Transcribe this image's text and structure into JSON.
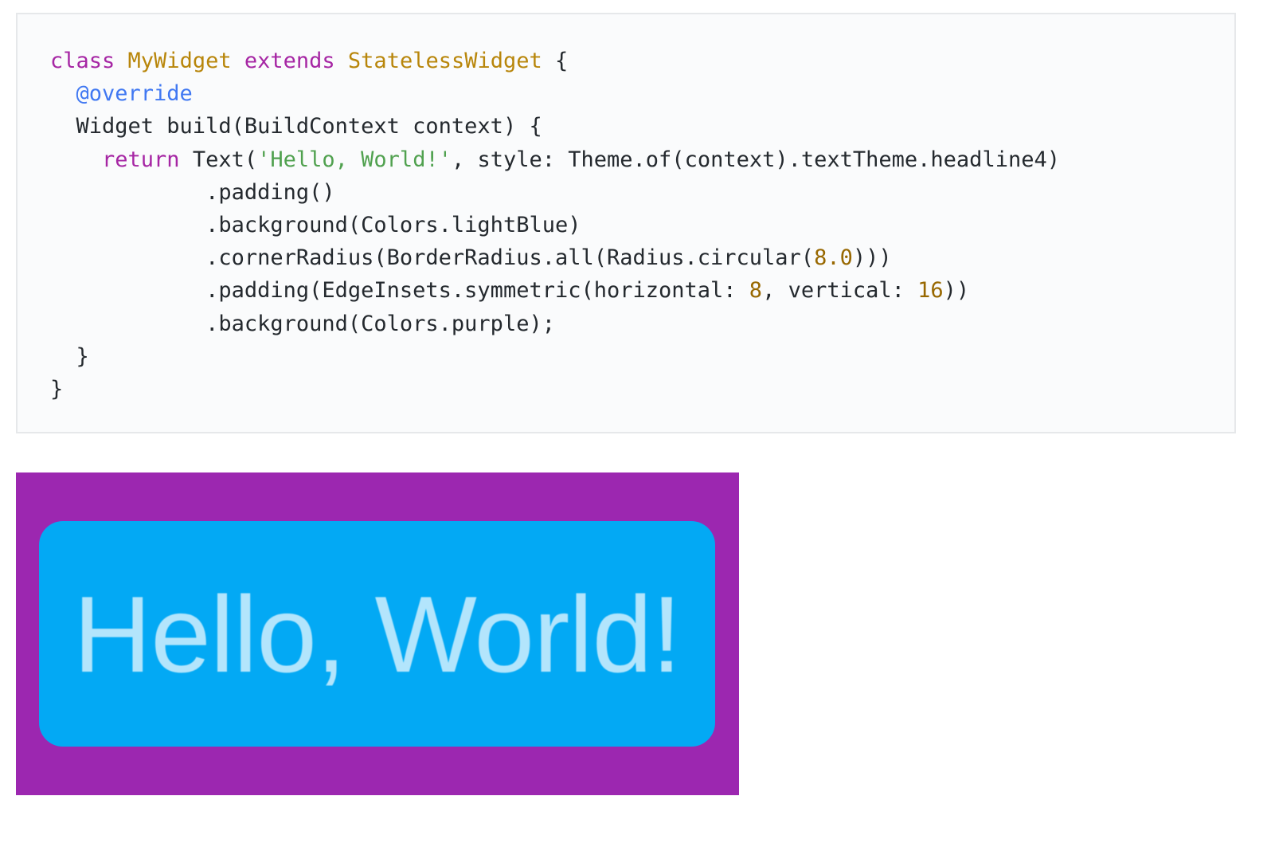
{
  "code": {
    "lines": [
      [
        {
          "t": "class",
          "c": "keyword"
        },
        {
          "t": " ",
          "c": "plain"
        },
        {
          "t": "MyWidget",
          "c": "class"
        },
        {
          "t": " ",
          "c": "plain"
        },
        {
          "t": "extends",
          "c": "keyword"
        },
        {
          "t": " ",
          "c": "plain"
        },
        {
          "t": "StatelessWidget",
          "c": "class"
        },
        {
          "t": " {",
          "c": "plain"
        }
      ],
      [
        {
          "t": "  ",
          "c": "plain"
        },
        {
          "t": "@override",
          "c": "meta"
        }
      ],
      [
        {
          "t": "  Widget build(BuildContext context) {",
          "c": "plain"
        }
      ],
      [
        {
          "t": "    ",
          "c": "plain"
        },
        {
          "t": "return",
          "c": "keyword"
        },
        {
          "t": " Text(",
          "c": "plain"
        },
        {
          "t": "'Hello, World!'",
          "c": "string"
        },
        {
          "t": ", style: Theme.of(context).textTheme.headline4)",
          "c": "plain"
        }
      ],
      [
        {
          "t": "            .padding()",
          "c": "plain"
        }
      ],
      [
        {
          "t": "            .background(Colors.lightBlue)",
          "c": "plain"
        }
      ],
      [
        {
          "t": "            .cornerRadius(BorderRadius.all(Radius.circular(",
          "c": "plain"
        },
        {
          "t": "8.0",
          "c": "number"
        },
        {
          "t": ")))",
          "c": "plain"
        }
      ],
      [
        {
          "t": "            .padding(EdgeInsets.symmetric(horizontal: ",
          "c": "plain"
        },
        {
          "t": "8",
          "c": "number"
        },
        {
          "t": ", vertical: ",
          "c": "plain"
        },
        {
          "t": "16",
          "c": "number"
        },
        {
          "t": "))",
          "c": "plain"
        }
      ],
      [
        {
          "t": "            .background(Colors.purple);",
          "c": "plain"
        }
      ],
      [
        {
          "t": "  }",
          "c": "plain"
        }
      ],
      [
        {
          "t": "}",
          "c": "plain"
        }
      ]
    ]
  },
  "preview": {
    "text": "Hello, World!",
    "outer_color": "#9c27b0",
    "inner_color": "#03a9f4",
    "text_color": "#b3e5fc"
  },
  "colors": {
    "code_background": "#fafbfc",
    "code_border": "#e6e8ea",
    "plain": "#24292e",
    "keyword": "#a626a4",
    "class": "#b8860b",
    "meta": "#4078f2",
    "string": "#50a14f",
    "number": "#986801"
  }
}
